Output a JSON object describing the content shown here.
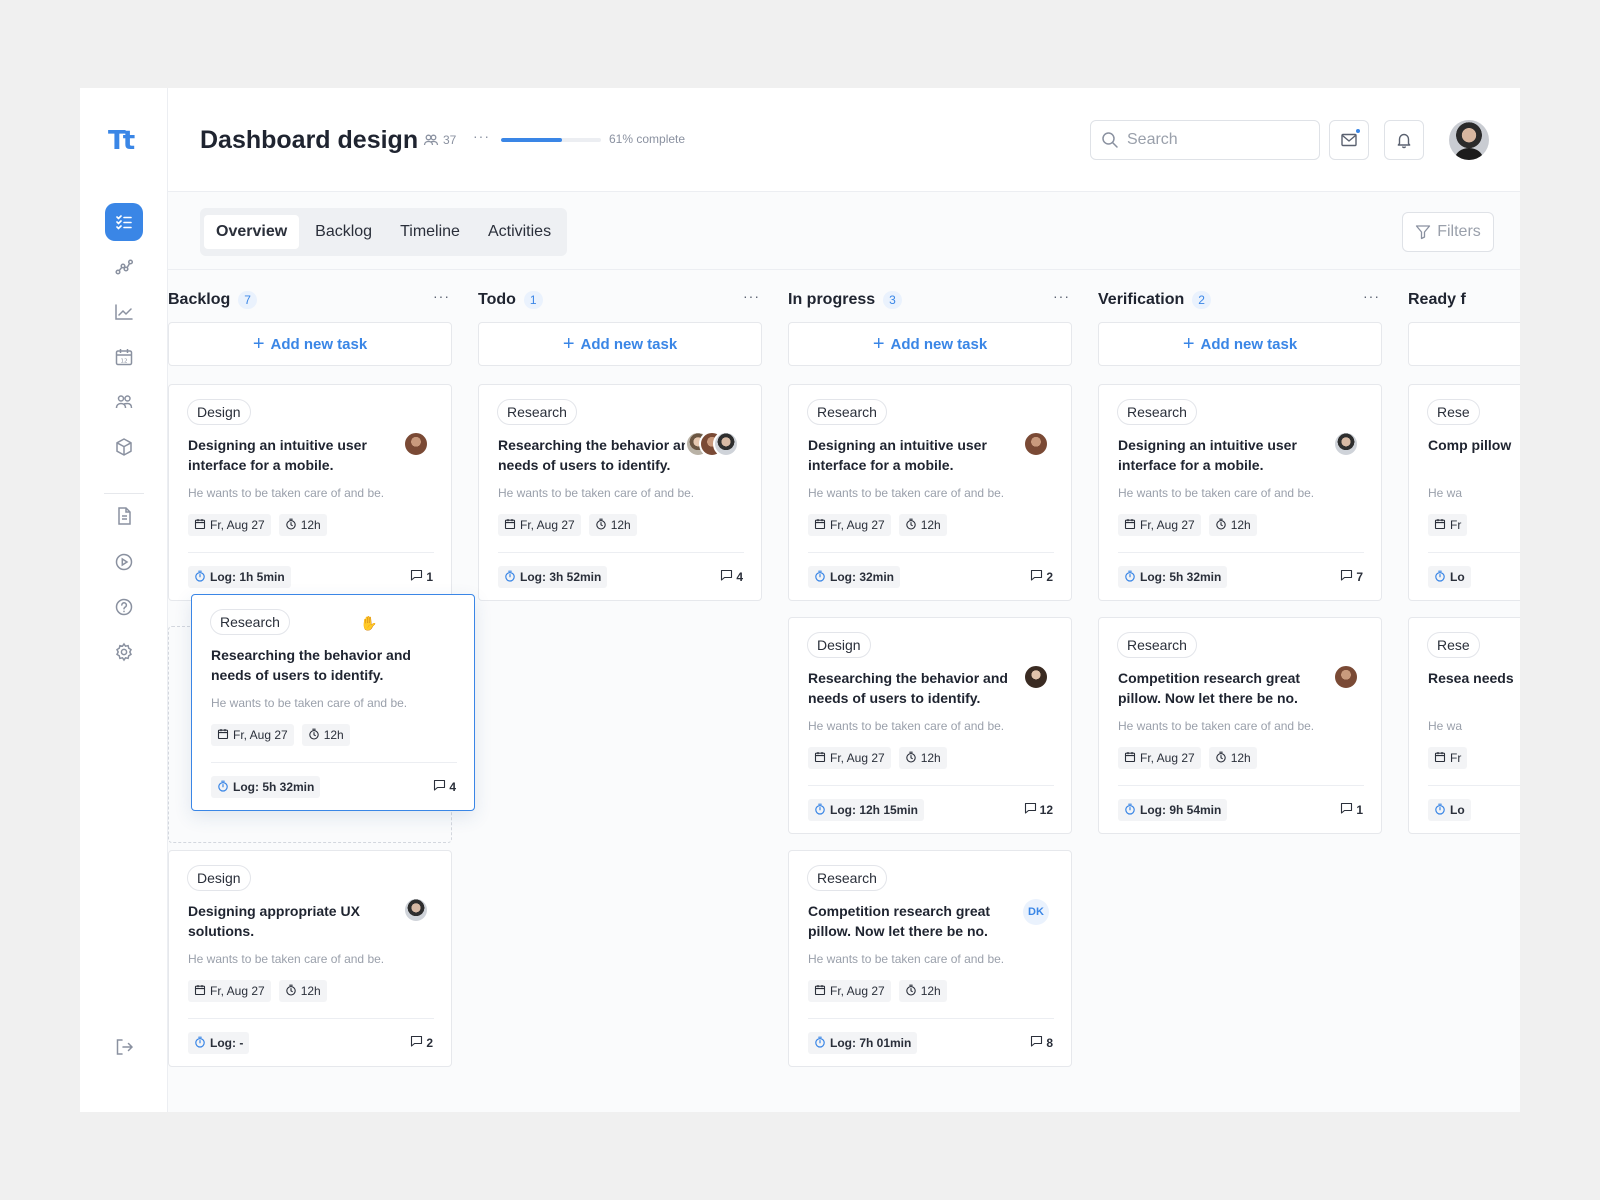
{
  "logo": "Tt",
  "header": {
    "title": "Dashboard design",
    "members_count": "37",
    "more": "···",
    "progress_percent": 61,
    "progress_text": "61% complete",
    "search_placeholder": "Search"
  },
  "tabs": [
    "Overview",
    "Backlog",
    "Timeline",
    "Activities"
  ],
  "filters_label": "Filters",
  "add_task_label": "Add new task",
  "columns": [
    {
      "title": "Backlog",
      "count": "7",
      "cards": [
        {
          "tag": "Design",
          "title": "Designing an intuitive user interface for a mobile.",
          "desc": "He wants to be taken care of and be.",
          "date": "Fr, Aug 27",
          "time": "12h",
          "log": "Log: 1h 5min",
          "comments": "1"
        },
        {
          "tag": "Research",
          "title": "Researching the behavior and needs of users to identify.",
          "desc": "He wants to be taken care of and be.",
          "date": "Fr, Aug 27",
          "time": "12h",
          "log": "Log: 5h 32min",
          "comments": "4"
        },
        {
          "tag": "Design",
          "title": "Designing appropriate UX solutions.",
          "desc": "He wants to be taken care of and be.",
          "date": "Fr, Aug 27",
          "time": "12h",
          "log": "Log: -",
          "comments": "2"
        }
      ]
    },
    {
      "title": "Todo",
      "count": "1",
      "cards": [
        {
          "tag": "Research",
          "title": "Researching the behavior and needs of users to identify.",
          "desc": "He wants to be taken care of and be.",
          "date": "Fr, Aug 27",
          "time": "12h",
          "log": "Log: 3h 52min",
          "comments": "4"
        }
      ]
    },
    {
      "title": "In progress",
      "count": "3",
      "cards": [
        {
          "tag": "Research",
          "title": "Designing an intuitive user interface for a mobile.",
          "desc": "He wants to be taken care of and be.",
          "date": "Fr, Aug 27",
          "time": "12h",
          "log": "Log: 32min",
          "comments": "2"
        },
        {
          "tag": "Design",
          "title": "Researching the behavior and needs of users to identify.",
          "desc": "He wants to be taken care of and be.",
          "date": "Fr, Aug 27",
          "time": "12h",
          "log": "Log: 12h 15min",
          "comments": "12"
        },
        {
          "tag": "Research",
          "title": "Competition research great pillow. Now let there be no.",
          "desc": "He wants to be taken care of and be.",
          "date": "Fr, Aug 27",
          "time": "12h",
          "log": "Log: 7h 01min",
          "comments": "8",
          "assignee_initials": "DK"
        }
      ]
    },
    {
      "title": "Verification",
      "count": "2",
      "cards": [
        {
          "tag": "Research",
          "title": "Designing an intuitive user interface for a mobile.",
          "desc": "He wants to be taken care of and be.",
          "date": "Fr, Aug 27",
          "time": "12h",
          "log": "Log: 5h 32min",
          "comments": "7"
        },
        {
          "tag": "Research",
          "title": "Competition research great pillow. Now let there be no.",
          "desc": "He wants to be taken care of and be.",
          "date": "Fr, Aug 27",
          "time": "12h",
          "log": "Log: 9h 54min",
          "comments": "1"
        }
      ]
    },
    {
      "title": "Ready f",
      "cards": [
        {
          "tag": "Rese",
          "title": "Comp pillow",
          "desc": "He wa",
          "date": "Fr",
          "log": "Lo"
        },
        {
          "tag": "Rese",
          "title": "Resea needs",
          "desc": "He wa",
          "date": "Fr",
          "log": "Lo"
        }
      ]
    }
  ],
  "colors": {
    "accent": "#3a86e6",
    "text": "#1f2430",
    "muted": "#9aa0ab"
  }
}
